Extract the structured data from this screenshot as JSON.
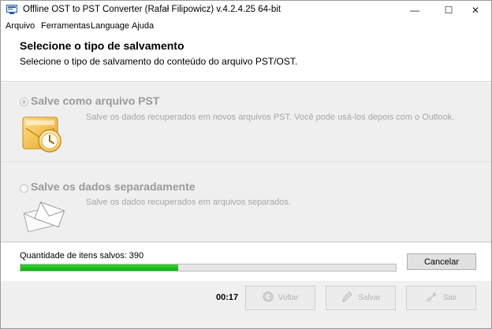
{
  "window": {
    "title": "Offline OST to PST Converter (Rafał Filipowicz) v.4.2.4.25 64-bit",
    "minimize_glyph": "—",
    "maximize_glyph": "☐",
    "close_glyph": "✕",
    "icons": [
      "app-icon",
      "minimize-icon",
      "maximize-icon",
      "close-icon"
    ]
  },
  "menu": {
    "items": [
      {
        "label": "Arquivo"
      },
      {
        "label": "Ferramentas"
      },
      {
        "label": "Language"
      },
      {
        "label": "Ajuda"
      }
    ]
  },
  "header": {
    "title": "Selecione o tipo de salvamento",
    "subtitle": "Selecione o tipo de salvamento do conteúdo do arquivo PST/OST."
  },
  "options": [
    {
      "title": "Salve como arquivo PST",
      "description": "Salve os dados recuperados em novos arquivos PST.  Você pode usá-los depois com o Outlook.",
      "selected": true,
      "icon": "outlook-icon"
    },
    {
      "title": "Salve os dados separadamente",
      "description": "Salve os dados recuperados em arquivos separados.",
      "selected": false,
      "icon": "envelopes-icon"
    }
  ],
  "progress": {
    "label": "Quantidade de itens salvos: 390",
    "percent": 42,
    "cancel_label": "Cancelar"
  },
  "footer": {
    "timer": "00:17",
    "back_label": "Voltar",
    "save_label": "Salvar",
    "exit_label": "Sair",
    "icons": [
      "back-arrow-icon",
      "save-pen-icon",
      "exit-icon"
    ]
  },
  "colors": {
    "progress_fill": "#1fc21f",
    "options_bg": "#efefef",
    "disabled_text": "#a6a6a6"
  }
}
